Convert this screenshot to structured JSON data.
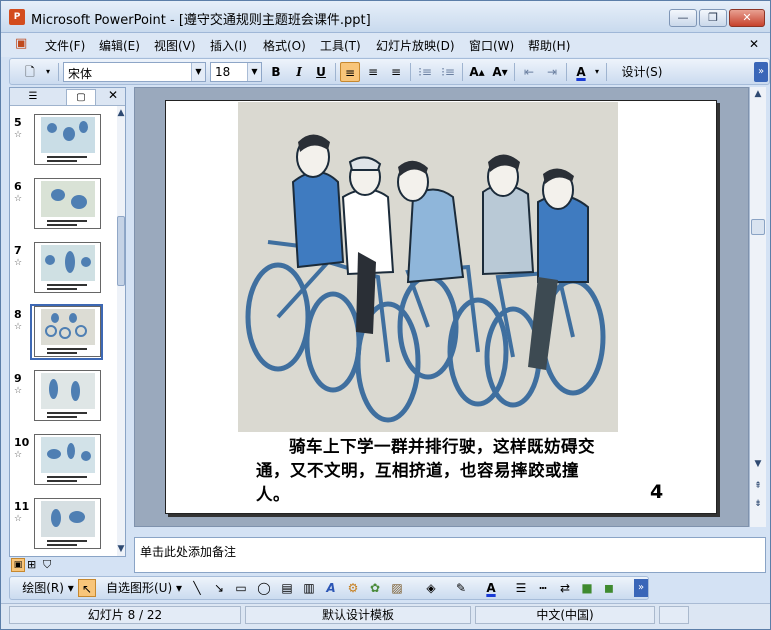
{
  "window": {
    "app_icon_text": "P",
    "title": "Microsoft PowerPoint - [遵守交通规则主题班会课件.ppt]",
    "minimize": "—",
    "maximize": "❐",
    "close": "✕"
  },
  "menubar": {
    "doc_icon": "▣",
    "items": [
      "文件(F)",
      "编辑(E)",
      "视图(V)",
      "插入(I)",
      "格式(O)",
      "工具(T)",
      "幻灯片放映(D)",
      "窗口(W)",
      "帮助(H)"
    ],
    "close_doc": "✕"
  },
  "toolbar": {
    "new_icon": "🗋",
    "font_name": "宋体",
    "font_size": "18",
    "bold": "B",
    "italic": "I",
    "underline": "U",
    "align_left": "≡",
    "align_center": "≡",
    "align_right": "≡",
    "numbering": "⁝≡",
    "bullets": "⁝≡",
    "increase_font": "A▴",
    "decrease_font": "A▾",
    "decrease_indent": "⇤",
    "increase_indent": "⇥",
    "font_color": "A",
    "design_label": "设计(S)",
    "overflow": "»"
  },
  "left_panel": {
    "tab_outline_icon": "☰",
    "tab_slides_icon": "▢",
    "close": "✕",
    "star": "☆",
    "slides": [
      {
        "number": "5"
      },
      {
        "number": "6"
      },
      {
        "number": "7"
      },
      {
        "number": "8",
        "selected": true
      },
      {
        "number": "9"
      },
      {
        "number": "10"
      },
      {
        "number": "11"
      }
    ]
  },
  "slide": {
    "caption": "骑车上下学一群并排行驶，这样既妨碍交通，又不文明，互相挤道，也容易摔跤或撞人。",
    "page_number": "4"
  },
  "scroll": {
    "up": "▲",
    "down": "▼",
    "prev_slide": "⇞",
    "next_slide": "⇟"
  },
  "notes": {
    "placeholder": "单击此处添加备注"
  },
  "view_buttons": [
    "▣",
    "⊞",
    "⛉"
  ],
  "drawbar": {
    "draw_menu": "绘图(R) ▾",
    "select_pointer": "↖",
    "autoshapes": "自选图形(U) ▾",
    "line": "╲",
    "arrow": "↘",
    "rectangle": "▭",
    "oval": "◯",
    "textbox": "▤",
    "vertical_textbox": "▥",
    "wordart": "A",
    "diagram": "⚙",
    "clipart": "✿",
    "picture": "▨",
    "fill_color": "◈",
    "line_color": "✎",
    "font_color": "A",
    "line_style": "☰",
    "dash_style": "┅",
    "arrow_style": "⇄",
    "shadow": "■",
    "three_d": "◼",
    "overflow": "»"
  },
  "statusbar": {
    "slide_position": "幻灯片 8 / 22",
    "template": "默认设计模板",
    "language": "中文(中国)"
  },
  "colors": {
    "chrome": "#d4e2f4",
    "accent_selected": "#3d68b4",
    "button_active": "#f8c57a",
    "illustration_blue": "#4f7fb3"
  }
}
